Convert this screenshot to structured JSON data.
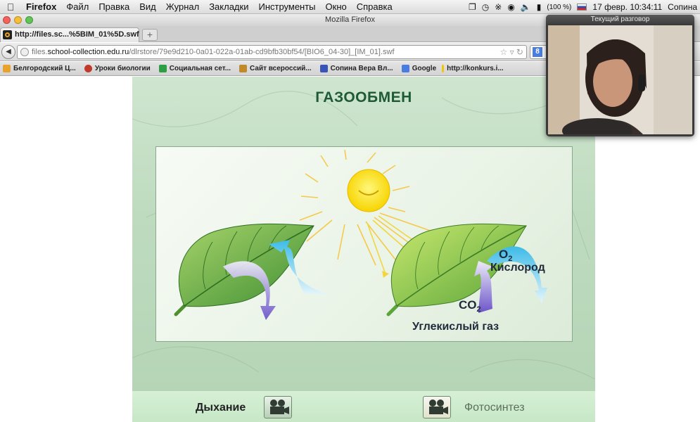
{
  "menubar": {
    "app": "Firefox",
    "items": [
      "Файл",
      "Правка",
      "Вид",
      "Журнал",
      "Закладки",
      "Инструменты",
      "Окно",
      "Справка"
    ],
    "battery": "(100 %)",
    "datetime": "17 февр.  10:34:11",
    "user": "Сопина"
  },
  "window": {
    "title": "Mozilla Firefox"
  },
  "tab": {
    "title": "http://files.sc...%5BIM_01%5D.swf",
    "new_tab": "+"
  },
  "url": {
    "prefix": "files.",
    "domain": "school-collection.edu.ru",
    "path": "/dlrstore/79e9d210-0a01-022a-01ab-cd9bfb30bf54/[BIO6_04-30]_[IM_01].swf"
  },
  "bookmarks": [
    {
      "label": "Белгородский Ц...",
      "color": "#e8a32c"
    },
    {
      "label": "Уроки биологии",
      "color": "#c0392b"
    },
    {
      "label": "Социальная сет...",
      "color": "#2e9e44"
    },
    {
      "label": "Сайт всероссий...",
      "color": "#c08a2a"
    },
    {
      "label": "Сопина Вера Вл...",
      "color": "#3a55b8"
    },
    {
      "label": "Google",
      "color": "#4a7de0"
    },
    {
      "label": "http://konkurs.i...",
      "color": "#f1c40f"
    }
  ],
  "flash": {
    "title": "ГАЗООБМЕН",
    "labels": {
      "o2_formula": "O",
      "o2_sub": "2",
      "o2_name": "Кислород",
      "co2_formula": "CO",
      "co2_sub": "2",
      "co2_name": "Углекислый газ"
    },
    "buttons": {
      "left": "Дыхание",
      "right": "Фотосинтез"
    }
  },
  "video": {
    "title": "Текущий разговор"
  },
  "colors": {
    "title_green": "#1f5a36",
    "panel_border": "#8aa88b",
    "inactive_text": "#5b6f5b"
  }
}
